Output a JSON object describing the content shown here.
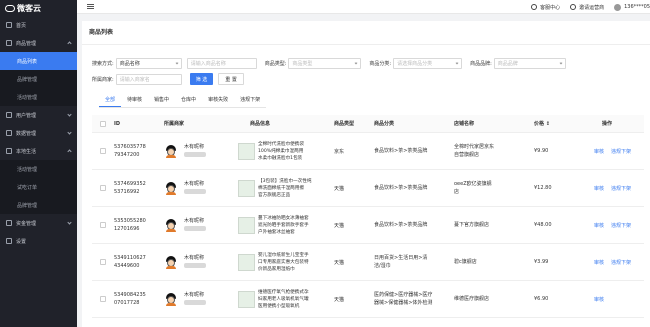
{
  "app": {
    "logo_text": "微客云"
  },
  "sidebar": {
    "items": [
      {
        "label": "首页",
        "icon": "home-icon",
        "type": "top"
      },
      {
        "label": "商品管理",
        "icon": "goods-icon",
        "type": "group",
        "open": true
      },
      {
        "label": "商品列表",
        "type": "sub",
        "active": true
      },
      {
        "label": "品牌管理",
        "type": "sub"
      },
      {
        "label": "活动管理",
        "type": "sub"
      },
      {
        "label": "用户管理",
        "icon": "user-icon",
        "type": "group"
      },
      {
        "label": "数据管理",
        "icon": "data-icon",
        "type": "group"
      },
      {
        "label": "本地生活",
        "icon": "local-icon",
        "type": "group",
        "open": true
      },
      {
        "label": "活动管理",
        "type": "sub"
      },
      {
        "label": "试吃订单",
        "type": "sub"
      },
      {
        "label": "品牌管理",
        "type": "sub"
      },
      {
        "label": "资金管理",
        "icon": "money-icon",
        "type": "group"
      },
      {
        "label": "设置",
        "icon": "settings-icon",
        "type": "top"
      }
    ]
  },
  "topbar": {
    "service": "客服中心",
    "invite": "邀请运营商",
    "phone": "136****05"
  },
  "page": {
    "title": "商品列表"
  },
  "filters": {
    "search_label": "搜索方式:",
    "search_mode": "商品名称",
    "search_placeholder": "请输入商品名称",
    "type_label": "商品类型:",
    "type_placeholder": "商品类型",
    "category_label": "商品分类:",
    "category_placeholder": "请选择商品分类",
    "brand_label": "商品品牌:",
    "brand_placeholder": "商品品牌",
    "merchant_label": "所属商家:",
    "merchant_placeholder": "请输入商家名",
    "filter_btn": "筛 选",
    "reset_btn": "重 置"
  },
  "tabs": [
    "全部",
    "待审核",
    "销售中",
    "仓库中",
    "审核失败",
    "违规下架"
  ],
  "table": {
    "headers": [
      "ID",
      "所属商家",
      "商品信息",
      "商品类型",
      "商品分类",
      "店铺名称",
      "价格 ↕",
      "操作"
    ],
    "rows": [
      {
        "id": "5376035778\n79347200",
        "merchant": "木有昵称",
        "info": "全棉时代洗脸巾便携袋\n100%纯棉柔巾湿两用\n水柔巾融洗脸巾1包装",
        "type": "京东",
        "category": "食品饮料>茶>茶类品牌",
        "store": "全棉时代家居京东\n自营旗舰店",
        "price": "¥9.90",
        "ops": [
          "审核",
          "违规下架"
        ]
      },
      {
        "id": "5374699352\n53716992",
        "merchant": "木有昵称",
        "info": "【3包装】洗脸巾一次性纯\n棉洗面棉纸干湿两用擦\n官方旗舰店正品",
        "type": "天猫",
        "category": "食品饮料>茶>茶类品牌",
        "store": "oeeZ欧亿姿旗舰\n店",
        "price": "¥12.80",
        "ops": [
          "审核",
          "违规下架"
        ]
      },
      {
        "id": "5353055280\n12701696",
        "merchant": "木有昵称",
        "info": "蔓下冰袖防晒女冰薄袖套\n遮光防晒手套新款手套手\n户外袖套冰丝袖套",
        "type": "天猫",
        "category": "食品饮料>茶>茶类品牌",
        "store": "蔓下官方旗舰店",
        "price": "¥48.00",
        "ops": [
          "审核",
          "违规下架"
        ]
      },
      {
        "id": "5349110627\n43449600",
        "merchant": "木有昵称",
        "info": "婴儿湿巾纸新生儿宝宝手\n口专用家庭实惠大包装特\n价新品家用湿纸巾",
        "type": "天猫",
        "category": "日用百货>生活日用>清\n洁/湿巾",
        "store": "碧c旗舰店",
        "price": "¥3.99",
        "ops": [
          "审核",
          "违规下架"
        ]
      },
      {
        "id": "5349084235\n07017728",
        "merchant": "木有昵称",
        "info": "维德医疗氧气枪便携式孕\n妇家用老人吸氧机氧气罐\n医用便携小型吸氧机",
        "type": "天猫",
        "category": "医药保健>医疗器械>医疗\n器械>保健器械>体外检测",
        "store": "维德医疗旗舰店",
        "price": "¥6.90",
        "ops": [
          "审核"
        ]
      }
    ]
  }
}
